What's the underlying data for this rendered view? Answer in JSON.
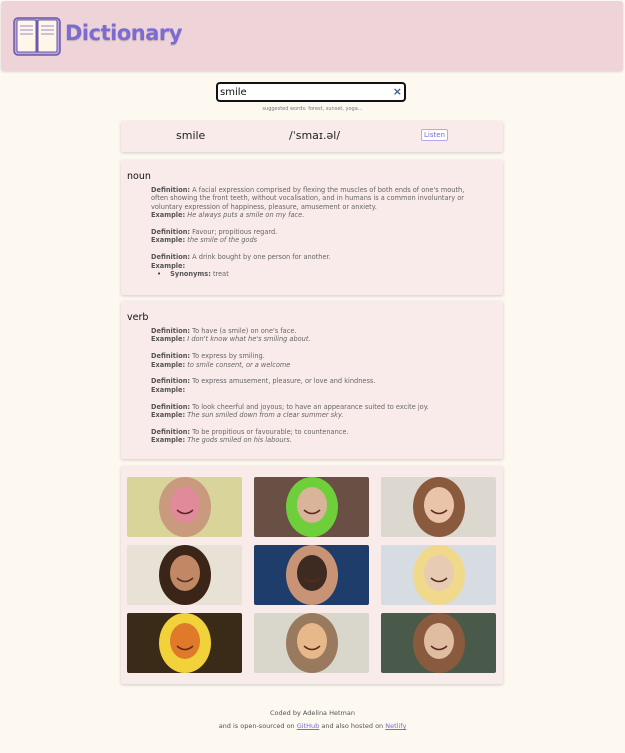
{
  "header": {
    "title": "Dictionary",
    "logo_icon": "open-book-icon"
  },
  "search": {
    "value": "smile",
    "clear_icon": "×",
    "suggestions": "suggested words: forest, sunset, yoga..."
  },
  "word": {
    "text": "smile",
    "phonetic": "/ˈsmaɪ.əl/",
    "listen_label": "Listen"
  },
  "meanings": [
    {
      "part_of_speech": "noun",
      "definitions": [
        {
          "definition_label": "Definition:",
          "definition": "A facial expression comprised by flexing the muscles of both ends of one's mouth, often showing the front teeth, without vocalisation, and in humans is a common involuntary or voluntary expression of happiness, pleasure, amusement or anxiety.",
          "example_label": "Example:",
          "example": "He always puts a smile on my face."
        },
        {
          "definition_label": "Definition:",
          "definition": "Favour; propitious regard.",
          "example_label": "Example:",
          "example": "the smile of the gods"
        },
        {
          "definition_label": "Definition:",
          "definition": "A drink bought by one person for another.",
          "example_label": "Example:",
          "example": "",
          "synonyms_label": "Synonyms:",
          "synonyms": "treat"
        }
      ]
    },
    {
      "part_of_speech": "verb",
      "definitions": [
        {
          "definition_label": "Definition:",
          "definition": "To have (a smile) on one's face.",
          "example_label": "Example:",
          "example": "I don't know what he's smiling about."
        },
        {
          "definition_label": "Definition:",
          "definition": "To express by smiling.",
          "example_label": "Example:",
          "example": "to smile consent, or a welcome"
        },
        {
          "definition_label": "Definition:",
          "definition": "To express amusement, pleasure, or love and kindness.",
          "example_label": "Example:",
          "example": ""
        },
        {
          "definition_label": "Definition:",
          "definition": "To look cheerful and joyous; to have an appearance suited to excite joy.",
          "example_label": "Example:",
          "example": "The sun smiled down from a clear summer sky."
        },
        {
          "definition_label": "Definition:",
          "definition": "To be propitious or favourable; to countenance.",
          "example_label": "Example:",
          "example": "The gods smiled on his labours."
        }
      ]
    }
  ],
  "photos": [
    {
      "bg": "#d8d49a",
      "accent": "#c99a7e",
      "detail": "#e08a9a"
    },
    {
      "bg": "#6a4f45",
      "accent": "#6ecf3a",
      "detail": "#d9b39a"
    },
    {
      "bg": "#dcd8cf",
      "accent": "#8a5a3e",
      "detail": "#e9c4a8"
    },
    {
      "bg": "#e8e2d6",
      "accent": "#3b2418",
      "detail": "#c08864"
    },
    {
      "bg": "#1f3d6a",
      "accent": "#c99476",
      "detail": "#3d2a20"
    },
    {
      "bg": "#d7dbe2",
      "accent": "#f1d98c",
      "detail": "#e7cbb3"
    },
    {
      "bg": "#3a2a18",
      "accent": "#f2d23a",
      "detail": "#e07a2a"
    },
    {
      "bg": "#d9d6cc",
      "accent": "#9a7a5e",
      "detail": "#e7b98a"
    },
    {
      "bg": "#4a5a4a",
      "accent": "#8a5a3e",
      "detail": "#e0bca0"
    }
  ],
  "footer": {
    "line1": "Coded by Adelina Hetman",
    "line2_prefix": "and is open-sourced on ",
    "github_label": "GitHub",
    "line2_middle": " and also hosted on ",
    "netlify_label": "Netlify"
  }
}
